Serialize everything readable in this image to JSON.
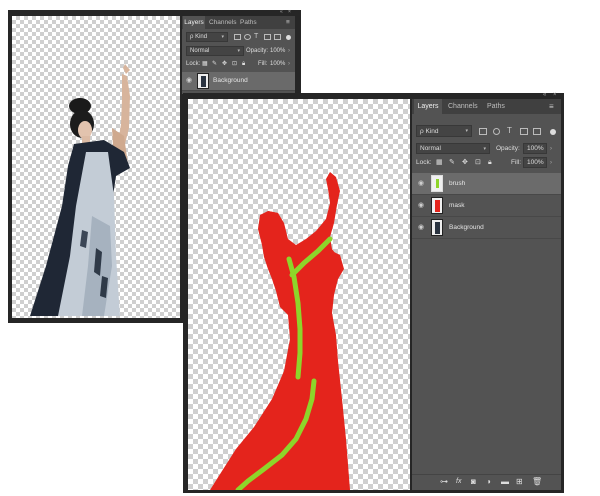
{
  "back_window": {
    "panel": {
      "tabs": [
        "Layers",
        "Channels",
        "Paths"
      ],
      "window_controls": [
        "«",
        "×"
      ],
      "filter": "ρ Kind",
      "blend_mode": "Normal",
      "opacity_label": "Opacity:",
      "opacity_value": "100%",
      "lock_label": "Lock:",
      "fill_label": "Fill:",
      "fill_value": "100%",
      "layers": [
        {
          "name": "Background"
        }
      ]
    }
  },
  "front_window": {
    "panel": {
      "tabs": [
        "Layers",
        "Channels",
        "Paths"
      ],
      "window_controls": [
        "«",
        "×"
      ],
      "filter": "ρ Kind",
      "blend_mode": "Normal",
      "opacity_label": "Opacity:",
      "opacity_value": "100%",
      "lock_label": "Lock:",
      "fill_label": "Fill:",
      "fill_value": "100%",
      "layers": [
        {
          "name": "brush"
        },
        {
          "name": "mask"
        },
        {
          "name": "Background"
        }
      ],
      "footer_icons": [
        "link-icon",
        "fx-icon",
        "layer-mask-icon",
        "adjustment-icon",
        "group-icon",
        "new-layer-icon",
        "trash-icon"
      ]
    }
  },
  "colors": {
    "mask_red": "#e4241c",
    "brush_green": "#8ed52a",
    "panel_bg": "#535353",
    "window_frame": "#262626"
  }
}
